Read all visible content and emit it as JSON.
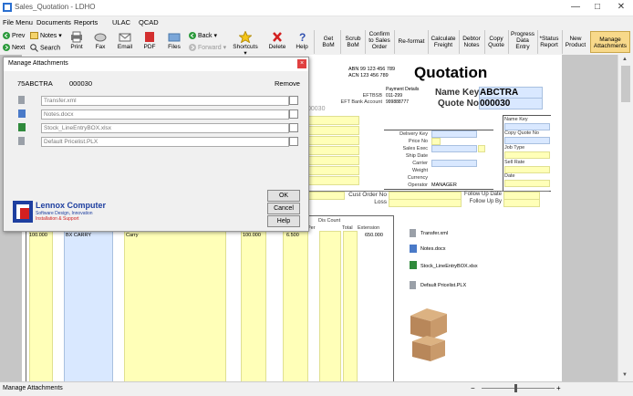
{
  "window": {
    "title": "Sales_Quotation - LDHO",
    "controls": [
      "minimize",
      "maximize",
      "close"
    ]
  },
  "menu": [
    "File Menu",
    "Documents",
    "Reports",
    "ULAC",
    "QCAD"
  ],
  "toolbar": {
    "prev": "Prev",
    "next": "Next",
    "notes": "Notes",
    "search": "Search",
    "print": "Print",
    "fax": "Fax",
    "email": "Email",
    "pdf": "PDF",
    "files": "Files",
    "back": "Back",
    "forward": "Forward",
    "shortcuts": "Shortcuts",
    "delete": "Delete",
    "help": "Help",
    "get_bom": [
      "Get",
      "BoM"
    ],
    "scrub_bom": [
      "Scrub",
      "BoM"
    ],
    "confirm": [
      "Confirm",
      "to Sales",
      "Order"
    ],
    "reformat": "Re-format",
    "calc_freight": [
      "Calculate",
      "Freight"
    ],
    "debtor_notes": [
      "Debtor",
      "Notes"
    ],
    "copy_quote": [
      "Copy",
      "Quote"
    ],
    "progress_entry": [
      "Progress",
      "Data",
      "Entry"
    ],
    "status_report": [
      "*Status",
      "Report"
    ],
    "new_product": [
      "New",
      "Product"
    ],
    "manage_attachments": [
      "Manage",
      "Attachments"
    ]
  },
  "quotation": {
    "heading": "Quotation",
    "abn": "ABN 99 123 456 789",
    "acn": "ACN 123 456 789",
    "payment_title": "Payment Details",
    "eftbsb_label": "EFTBSB",
    "eftbsb_value": "011-299",
    "eft_label": "EFT Bank Account",
    "eft_value": "999888777",
    "name_key_label": "Name Key",
    "name_key_value": "ABCTRA",
    "quote_no_label": "Quote No",
    "quote_no_value": "000030",
    "quote_no_ghost": "00030",
    "mid_labels": [
      "Delivery Key",
      "Price No",
      "Sales Exec",
      "Ship Date",
      "Carrier",
      "Weight",
      "Currency",
      "Operator"
    ],
    "operator_value": "MANAGER",
    "right_labels": [
      "Name Key",
      "Copy Quote No",
      "Job Type",
      "Sell Rate",
      "Date"
    ],
    "cust_order_label": "Cust Order No",
    "loss_label": "Loss",
    "follow_up_date": "Follow Up Date",
    "follow_up_by": "Follow Up By",
    "dis_count": "Dis Count",
    "per_label": "Per",
    "total_label": "Total",
    "extension_label": "Extension",
    "line1": {
      "qty": "100.000",
      "code": "BX CARRY",
      "desc": "Carry",
      "qty2": "100.000",
      "price": "6.500",
      "ext": "650.000"
    }
  },
  "attachments_panel": {
    "files": [
      "Transfer.xml",
      "Notes.docx",
      "Stock_LineEntryBOX.xlsx",
      "Default Pricelist.PLX"
    ]
  },
  "dialog": {
    "title": "Manage Attachments",
    "name_key": "75ABCTRA",
    "quote_no": "000030",
    "remove_label": "Remove",
    "files": [
      "Transfer.xml",
      "Notes.docx",
      "Stock_LineEntryBOX.xlsx",
      "Default Pricelist.PLX"
    ],
    "ok": "OK",
    "cancel": "Cancel",
    "help": "Help",
    "logo_name": "Lennox Computer",
    "logo_line1": "Software Design, Innovation",
    "logo_line2": "Installation & Support"
  },
  "status": {
    "text": "Manage Attachments",
    "zoom_minus": "−",
    "zoom_plus": "+"
  }
}
